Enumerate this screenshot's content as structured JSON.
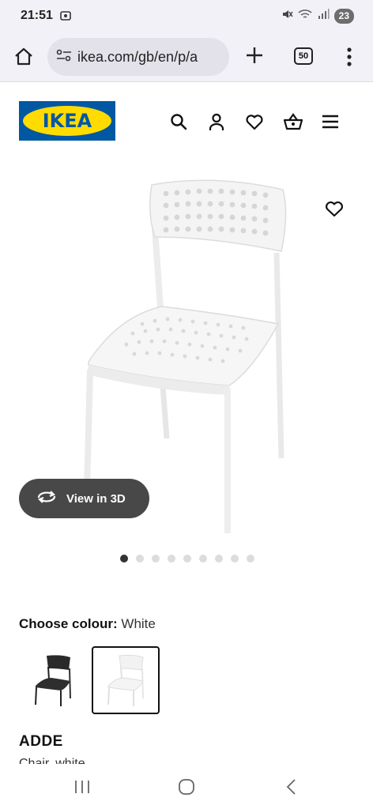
{
  "status_bar": {
    "time": "21:51",
    "battery": "23"
  },
  "browser": {
    "url": "ikea.com/gb/en/p/a",
    "tab_count": "50"
  },
  "site": {
    "logo_text": "IKEA"
  },
  "gallery": {
    "view_3d_label": "View in 3D",
    "image_count": 9,
    "active_index": 0
  },
  "product": {
    "choose_colour_label": "Choose colour:",
    "selected_colour": "White",
    "name": "ADDE",
    "description": "Chair, white"
  },
  "colors": {
    "ikea_blue": "#0058a3",
    "ikea_yellow": "#ffdb00",
    "view3d_bg": "#484848"
  }
}
